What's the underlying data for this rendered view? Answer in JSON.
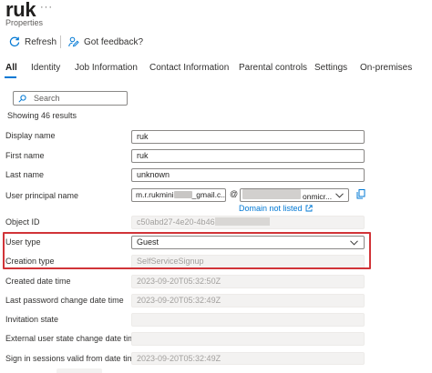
{
  "header": {
    "title": "ruk",
    "more": "···",
    "subtitle": "Properties"
  },
  "commands": {
    "refresh": "Refresh",
    "feedback": "Got feedback?"
  },
  "tabs": [
    "All",
    "Identity",
    "Job Information",
    "Contact Information",
    "Parental controls",
    "Settings",
    "On-premises"
  ],
  "search": {
    "placeholder": "Search"
  },
  "results": "Showing 46 results",
  "fields": {
    "display_name": {
      "label": "Display name",
      "value": "ruk"
    },
    "first_name": {
      "label": "First name",
      "value": "ruk"
    },
    "last_name": {
      "label": "Last name",
      "value": "unknown"
    },
    "upn": {
      "label": "User principal name",
      "value_start": "m.r.rukmini",
      "value_end": "_gmail.c...",
      "at": "@",
      "domain_suffix": "onmicr...",
      "link": "Domain not listed"
    },
    "object_id": {
      "label": "Object ID",
      "value_start": "c50abd27-4e20-4b46"
    },
    "user_type": {
      "label": "User type",
      "value": "Guest"
    },
    "creation_type": {
      "label": "Creation type",
      "value": "SelfServiceSignup"
    },
    "created": {
      "label": "Created date time",
      "value": "2023-09-20T05:32:50Z"
    },
    "last_pw": {
      "label": "Last password change date time",
      "value": "2023-09-20T05:32:49Z"
    },
    "invitation": {
      "label": "Invitation state",
      "value": ""
    },
    "ext_state": {
      "label": "External user state change date time",
      "value": ""
    },
    "sign_in": {
      "label": "Sign in sessions valid from date time",
      "value": "2023-09-20T05:32:49Z"
    }
  },
  "colors": {
    "accent": "#0078d4",
    "highlight": "#d13438"
  }
}
